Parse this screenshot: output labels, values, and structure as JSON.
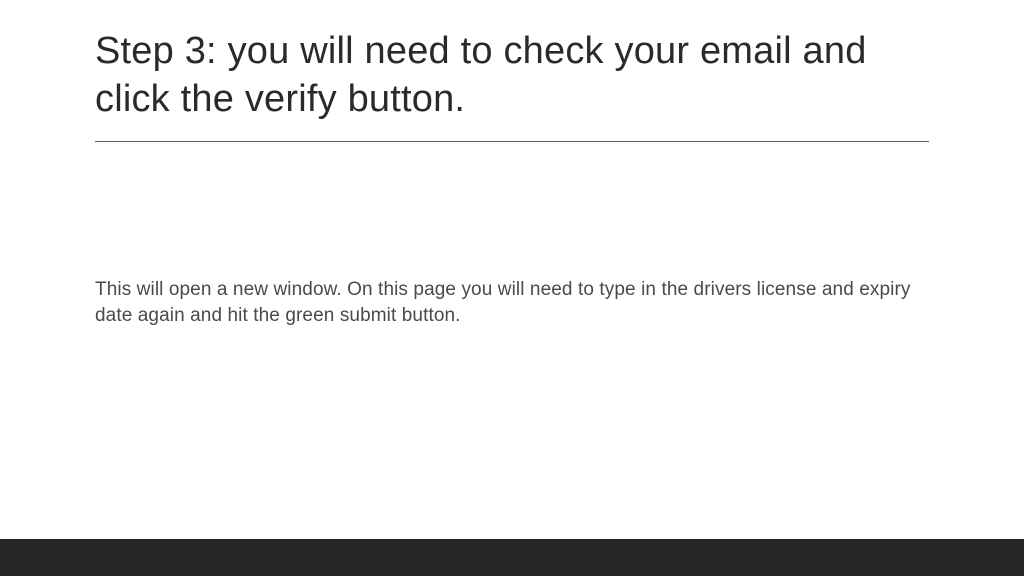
{
  "slide": {
    "title": "Step 3: you will need to check your email and click the verify button.",
    "body": "This will open a new window.  On this page you will need to type in the drivers license and expiry date again and hit the green submit button."
  }
}
